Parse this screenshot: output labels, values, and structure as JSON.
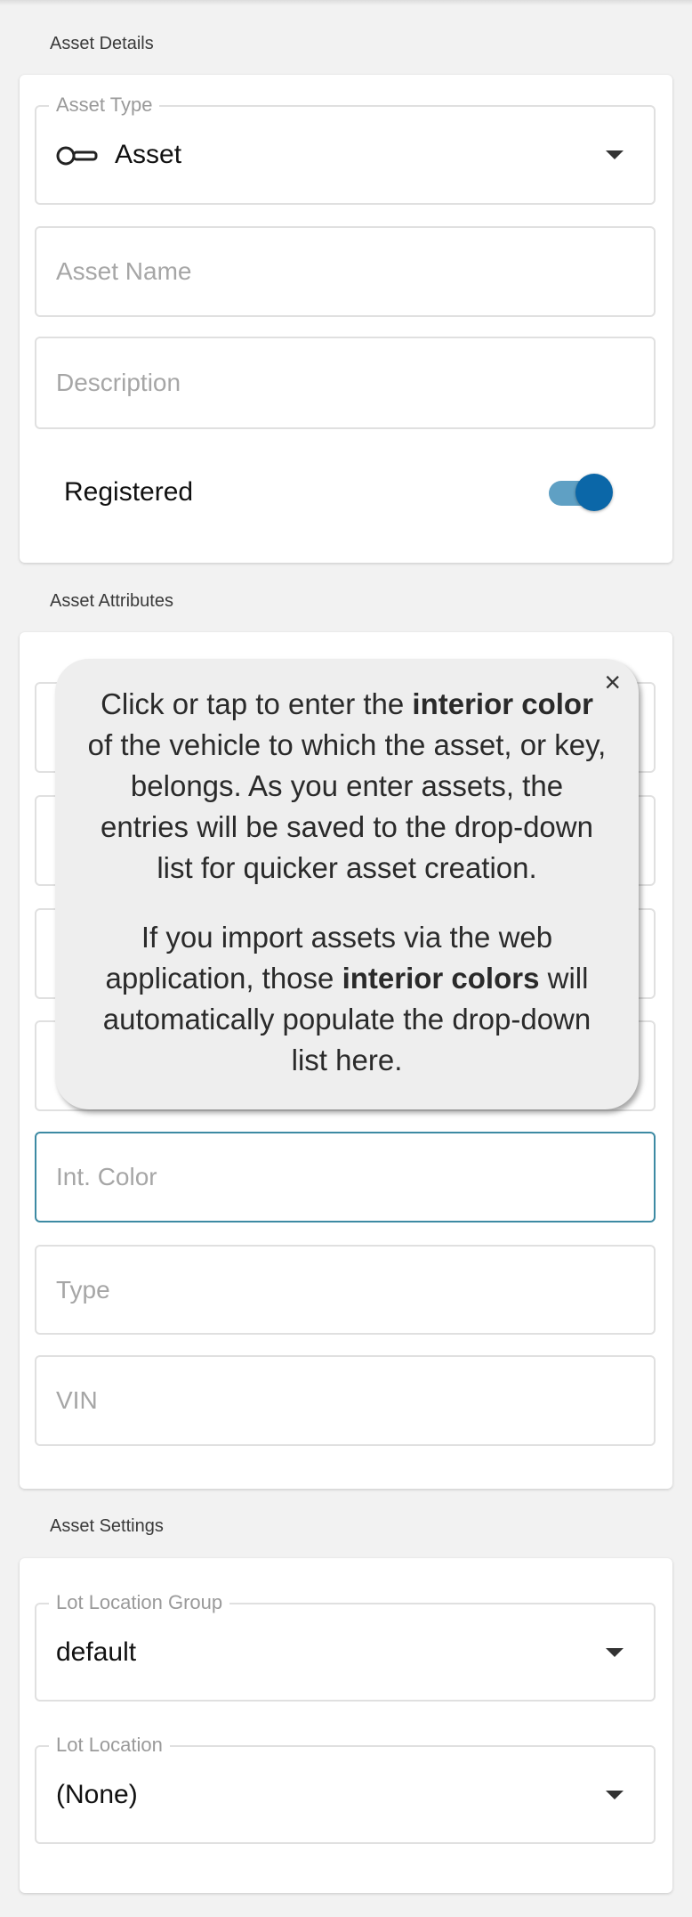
{
  "sections": {
    "details_title": "Asset Details",
    "attributes_title": "Asset Attributes",
    "settings_title": "Asset Settings"
  },
  "details": {
    "asset_type_label": "Asset Type",
    "asset_type_value": "Asset",
    "asset_type_icon": "key-icon",
    "asset_name_placeholder": "Asset Name",
    "description_placeholder": "Description",
    "registered_label": "Registered",
    "registered_on": true
  },
  "attributes": {
    "int_color_placeholder": "Int. Color",
    "type_placeholder": "Type",
    "vin_placeholder": "VIN"
  },
  "tooltip": {
    "p1_before": "Click or tap to enter the ",
    "p1_bold": "interior color",
    "p1_after": " of the vehicle to which the asset, or key, belongs. As you enter assets, the entries will be saved to the drop-down list for quicker asset creation.",
    "p2_before": "If you import assets via the web application, those ",
    "p2_bold": "interior colors",
    "p2_after": " will automatically populate the drop-down list here.",
    "close_symbol": "×"
  },
  "settings": {
    "lot_location_group_label": "Lot Location Group",
    "lot_location_group_value": "default",
    "lot_location_label": "Lot Location",
    "lot_location_value": "(None)"
  },
  "colors": {
    "accent": "#0b67a8",
    "focus_border": "#3d8aa3"
  }
}
